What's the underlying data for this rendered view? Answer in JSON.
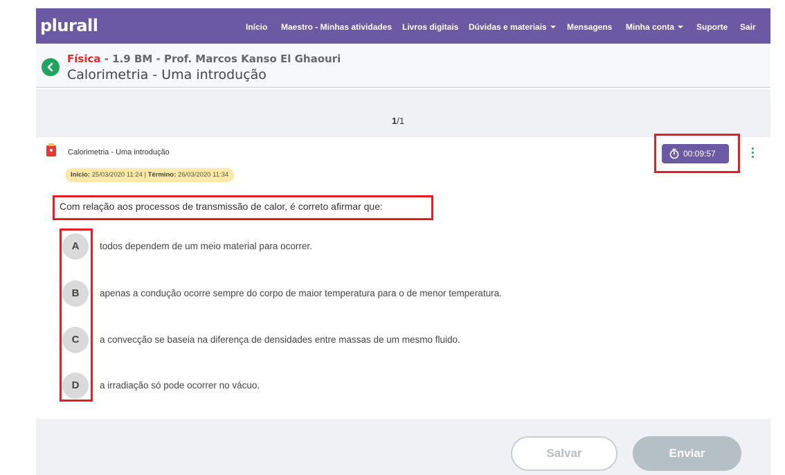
{
  "nav": {
    "logo": "plurall",
    "items": [
      {
        "label": "Início",
        "dropdown": false
      },
      {
        "label": "Maestro - Minhas atividades",
        "dropdown": false
      },
      {
        "label": "Livros digitais",
        "dropdown": false
      },
      {
        "label": "Dúvidas e materiais",
        "dropdown": true
      },
      {
        "label": "Mensagens",
        "dropdown": false
      },
      {
        "label": "Minha conta",
        "dropdown": true
      },
      {
        "label": "Suporte",
        "dropdown": false
      },
      {
        "label": "Sair",
        "dropdown": false
      }
    ]
  },
  "header": {
    "back_icon": "chevron-left-icon",
    "subject": "Física",
    "course_rest": " - 1.9 BM - Prof. Marcos Kanso El Ghaouri",
    "title": "Calorimetria - Uma introdução"
  },
  "pager": {
    "current": "1",
    "total": "/1"
  },
  "activity": {
    "icon": "stopwatch-document-icon",
    "title": "Calorimetria - Uma introdução",
    "start_label": "Início:",
    "start_value": " 25/03/2020 11:24 | ",
    "end_label": "Término:",
    "end_value": " 26/03/2020 11:34",
    "timer": "00:09:57"
  },
  "question": {
    "text": "Com relação aos processos de transmissão de calor, é correto afirmar que:",
    "options": [
      {
        "letter": "A",
        "text": "todos dependem de um meio material para ocorrer."
      },
      {
        "letter": "B",
        "text": "apenas a condução ocorre sempre do corpo de maior temperatura para o de menor temperatura."
      },
      {
        "letter": "C",
        "text": "a convecção se baseia na diferença de densidades entre massas de um mesmo fluido."
      },
      {
        "letter": "D",
        "text": "a irradiação só pode ocorrer no vácuo."
      }
    ]
  },
  "actions": {
    "save": "Salvar",
    "send": "Enviar"
  },
  "colors": {
    "brand": "#6b59a3",
    "accent_green": "#1fa560",
    "subject_red": "#e8262b",
    "highlight_red": "#e31e24",
    "date_pill": "#fbe9a6"
  }
}
